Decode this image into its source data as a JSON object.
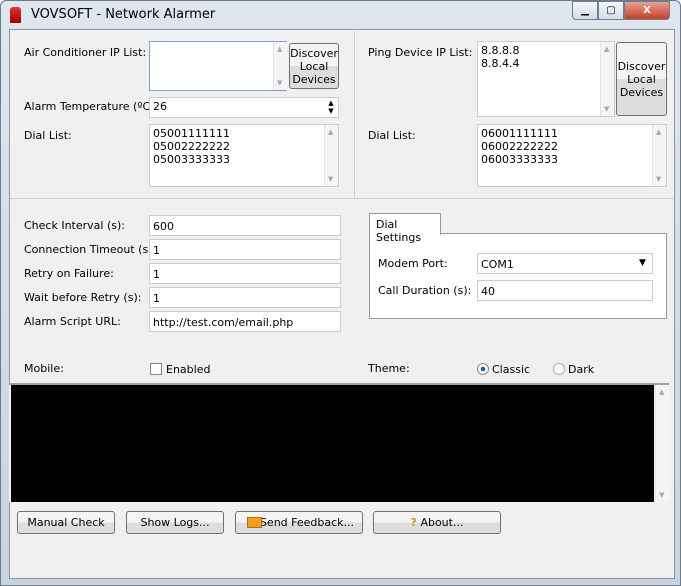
{
  "window": {
    "title": "VOVSOFT - Network Alarmer",
    "controls": [
      "minimize",
      "maximize",
      "close"
    ]
  },
  "left": {
    "ac_label": "Air Conditioner IP List:",
    "ac_value": "",
    "discover_label": "Discover Local Devices",
    "temp_label": "Alarm Temperature (ºC):",
    "temp_value": "26",
    "dial_label": "Dial List:",
    "dial_value": "05001111111\n05002222222\n05003333333"
  },
  "right": {
    "ping_label": "Ping Device IP List:",
    "ping_value": "8.8.8.8\n8.8.4.4",
    "discover_label": "Discover Local Devices",
    "dial_label": "Dial List:",
    "dial_value": "06001111111\n06002222222\n06003333333"
  },
  "settings": [
    {
      "label": "Check Interval (s):",
      "value": "600"
    },
    {
      "label": "Connection Timeout (s):",
      "value": "1"
    },
    {
      "label": "Retry on Failure:",
      "value": "1"
    },
    {
      "label": "Wait before Retry (s):",
      "value": "1"
    },
    {
      "label": "Alarm Script URL:",
      "value": "http://test.com/email.php"
    }
  ],
  "dial_settings": {
    "tab": "Dial Settings",
    "modem_label": "Modem Port:",
    "modem_value": "COM1",
    "duration_label": "Call Duration (s):",
    "duration_value": "40"
  },
  "mobile": {
    "label": "Mobile:",
    "checkbox_label": "Enabled",
    "checked": false
  },
  "theme": {
    "label": "Theme:",
    "options": [
      "Classic",
      "Dark"
    ],
    "selected": "Classic"
  },
  "log": {
    "text": ""
  },
  "buttons": {
    "manual": "Manual Check",
    "logs": "Show Logs...",
    "feedback": "Send Feedback...",
    "about": "About..."
  }
}
